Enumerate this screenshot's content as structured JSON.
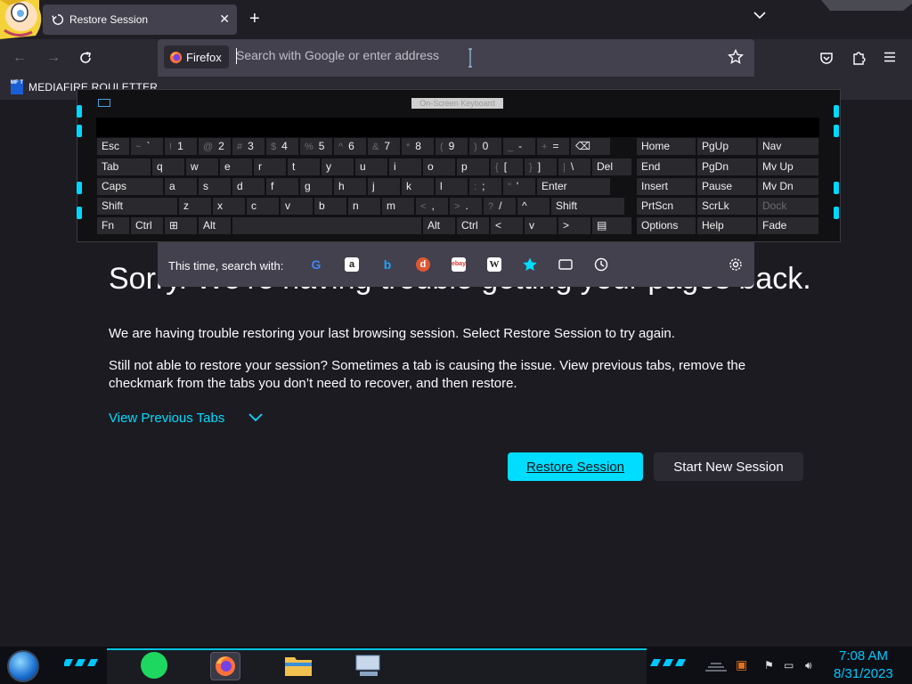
{
  "browser": {
    "tab_title": "Restore Session",
    "identity_label": "Firefox",
    "url_placeholder": "Search with Google or enter address",
    "bookmark_label": "MEDIAFIRE ROULETTER",
    "bookmark_icon_text": "MF T"
  },
  "page": {
    "heading": "Sorry. We’re having trouble getting your pages back.",
    "p1": "We are having trouble restoring your last browsing session. Select Restore Session to try again.",
    "p2": "Still not able to restore your session? Sometimes a tab is causing the issue. View previous tabs, remove the checkmark from the tabs you don’t need to recover, and then restore.",
    "view_previous": "View Previous Tabs",
    "restore_btn": "Restore Session",
    "new_session_btn": "Start New Session"
  },
  "search_with": {
    "label": "This time, search with:",
    "engines": [
      "google-icon",
      "amazon-icon",
      "bing-icon",
      "duckduckgo-icon",
      "ebay-icon",
      "wikipedia-icon",
      "bookmarks-icon",
      "tabs-icon",
      "history-icon"
    ]
  },
  "osk": {
    "title": "On-Screen Keyboard",
    "rows": [
      [
        [
          "Esc",
          ""
        ],
        [
          "`",
          "~"
        ],
        [
          "1",
          "!"
        ],
        [
          "2",
          "@"
        ],
        [
          "3",
          "#"
        ],
        [
          "4",
          "$"
        ],
        [
          "5",
          "%"
        ],
        [
          "6",
          "^"
        ],
        [
          "7",
          "&"
        ],
        [
          "8",
          "*"
        ],
        [
          "9",
          "("
        ],
        [
          "0",
          ")"
        ],
        [
          "-",
          "_"
        ],
        [
          "=",
          "+"
        ],
        [
          "⌫",
          ""
        ]
      ],
      [
        [
          "Tab",
          ""
        ],
        [
          "q",
          ""
        ],
        [
          "w",
          ""
        ],
        [
          "e",
          ""
        ],
        [
          "r",
          ""
        ],
        [
          "t",
          ""
        ],
        [
          "y",
          ""
        ],
        [
          "u",
          ""
        ],
        [
          "i",
          ""
        ],
        [
          "o",
          ""
        ],
        [
          "p",
          ""
        ],
        [
          "[",
          "{"
        ],
        [
          "]",
          "}"
        ],
        [
          "\\",
          "|"
        ],
        [
          "Del",
          ""
        ]
      ],
      [
        [
          "Caps",
          ""
        ],
        [
          "a",
          ""
        ],
        [
          "s",
          ""
        ],
        [
          "d",
          ""
        ],
        [
          "f",
          ""
        ],
        [
          "g",
          ""
        ],
        [
          "h",
          ""
        ],
        [
          "j",
          ""
        ],
        [
          "k",
          ""
        ],
        [
          "l",
          ""
        ],
        [
          ";",
          ":"
        ],
        [
          "'",
          "\""
        ],
        [
          "Enter",
          ""
        ]
      ],
      [
        [
          "Shift",
          ""
        ],
        [
          "z",
          ""
        ],
        [
          "x",
          ""
        ],
        [
          "c",
          ""
        ],
        [
          "v",
          ""
        ],
        [
          "b",
          ""
        ],
        [
          "n",
          ""
        ],
        [
          "m",
          ""
        ],
        [
          ",",
          "<"
        ],
        [
          ".",
          ">"
        ],
        [
          "/",
          "?"
        ],
        [
          "^",
          ""
        ],
        [
          "Shift",
          ""
        ]
      ],
      [
        [
          "Fn",
          ""
        ],
        [
          "Ctrl",
          ""
        ],
        [
          "⊞",
          ""
        ],
        [
          "Alt",
          ""
        ],
        [
          "",
          ""
        ],
        [
          "Alt",
          ""
        ],
        [
          "Ctrl",
          ""
        ],
        [
          "<",
          ""
        ],
        [
          "v",
          ""
        ],
        [
          ">",
          ""
        ],
        [
          "▤",
          ""
        ]
      ]
    ],
    "nav": [
      [
        "Home",
        "PgUp",
        "Nav"
      ],
      [
        "End",
        "PgDn",
        "Mv Up"
      ],
      [
        "Insert",
        "Pause",
        "Mv Dn"
      ],
      [
        "PrtScn",
        "ScrLk",
        "Dock"
      ],
      [
        "Options",
        "Help",
        "Fade"
      ]
    ]
  },
  "taskbar": {
    "time": "7:08 AM",
    "date": "8/31/2023"
  }
}
